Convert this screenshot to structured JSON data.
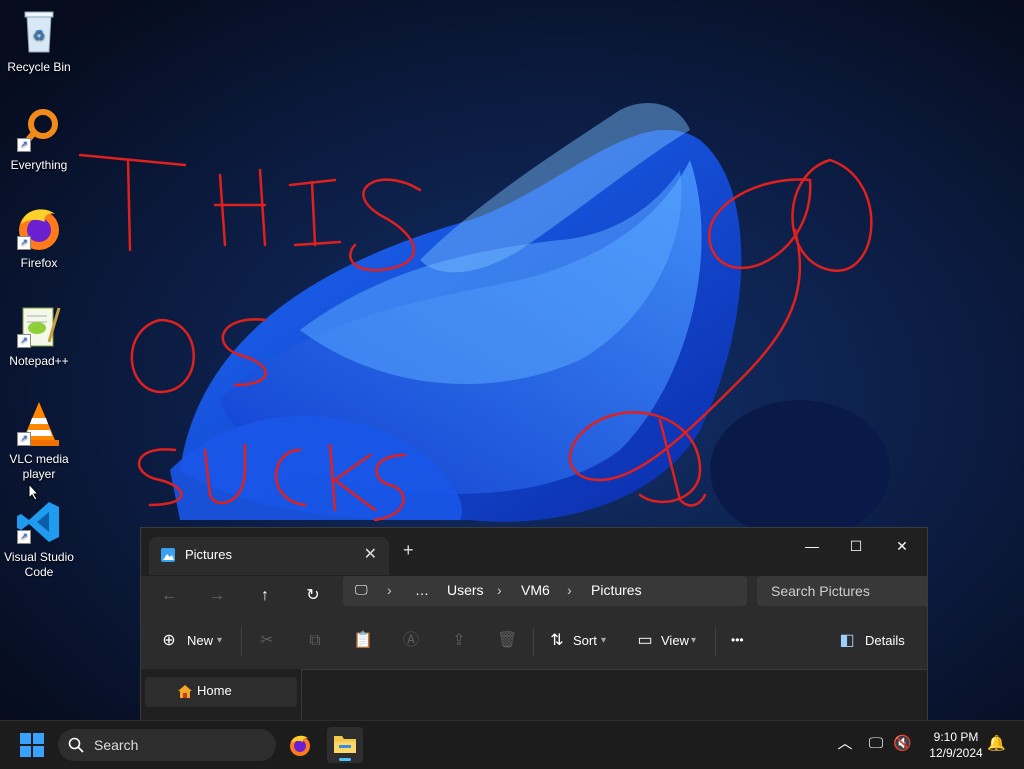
{
  "desktop": {
    "scribble": "THIS OS SUCKS",
    "icons": [
      {
        "label": "Recycle Bin",
        "icon": "recycle-bin-icon"
      },
      {
        "label": "Everything",
        "icon": "everything-search-icon"
      },
      {
        "label": "Firefox",
        "icon": "firefox-icon"
      },
      {
        "label": "Notepad++",
        "icon": "notepad-plus-plus-icon"
      },
      {
        "label": "VLC media\nplayer",
        "icon": "vlc-icon"
      },
      {
        "label": "Visual Studio\nCode",
        "icon": "vscode-icon"
      }
    ]
  },
  "explorer": {
    "tab_title": "Pictures",
    "tab_close": "✕",
    "new_tab": "+",
    "window_buttons": {
      "minimize": "—",
      "maximize": "☐",
      "close": "✕"
    },
    "breadcrumb": [
      "…",
      "Users",
      "VM6",
      "Pictures"
    ],
    "search_placeholder": "Search Pictures",
    "commands": {
      "new": "New",
      "sort": "Sort",
      "view": "View",
      "more": "•••",
      "details": "Details"
    },
    "sidebar": {
      "home": "Home"
    }
  },
  "taskbar": {
    "search_placeholder": "Search",
    "time": "9:10 PM",
    "date": "12/9/2024"
  }
}
